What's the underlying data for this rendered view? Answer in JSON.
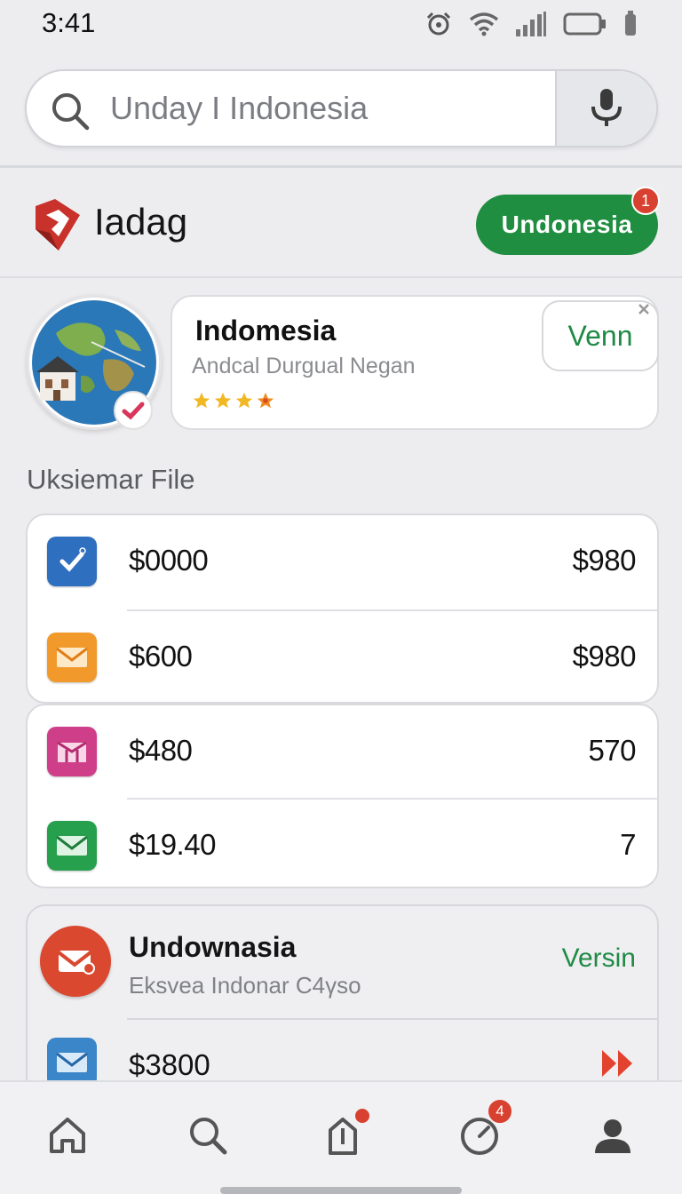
{
  "status_bar": {
    "time": "3:41",
    "icons": [
      "alarm-icon",
      "wifi-icon",
      "signal-icon",
      "battery-icon",
      "notification-icon"
    ]
  },
  "search": {
    "value": "Unday I Indonesia",
    "search_icon": "search-icon",
    "mic_icon": "microphone-icon"
  },
  "brand": {
    "name": "Iadag",
    "logo": "brand-logo-icon",
    "region_button": "Undonesia",
    "region_badge": "1",
    "brand_color": "#1f8e40"
  },
  "profile": {
    "name": "Indomesia",
    "subtitle": "Andcal Durgual Negan",
    "rating_stars": 4,
    "view_button": "Venn"
  },
  "section": {
    "title": "Uksiemar File"
  },
  "list_groups": [
    {
      "rows": [
        {
          "icon": "checkbox-icon",
          "icon_color": "#2f6fc0",
          "label": "$0000",
          "value": "$980"
        },
        {
          "icon": "mail-icon",
          "icon_color": "#f19a2b",
          "label": "$600",
          "value": "$980"
        }
      ]
    },
    {
      "rows": [
        {
          "icon": "inbox-icon",
          "icon_color": "#cf3f89",
          "label": "$480",
          "value": "570"
        },
        {
          "icon": "mail-icon",
          "icon_color": "#27a04d",
          "label": "$19.40",
          "value": "7"
        }
      ]
    }
  ],
  "message": {
    "title": "Undownasia",
    "subtitle": "Eksvea Indonar C4γso",
    "action": "Versin",
    "row_label": "$3800",
    "row_action_icon": "fast-forward-icon"
  },
  "bottom_nav": {
    "items": [
      "home-icon",
      "search-icon",
      "share-icon",
      "timer-icon",
      "profile-icon"
    ],
    "timer_badge": "4"
  }
}
